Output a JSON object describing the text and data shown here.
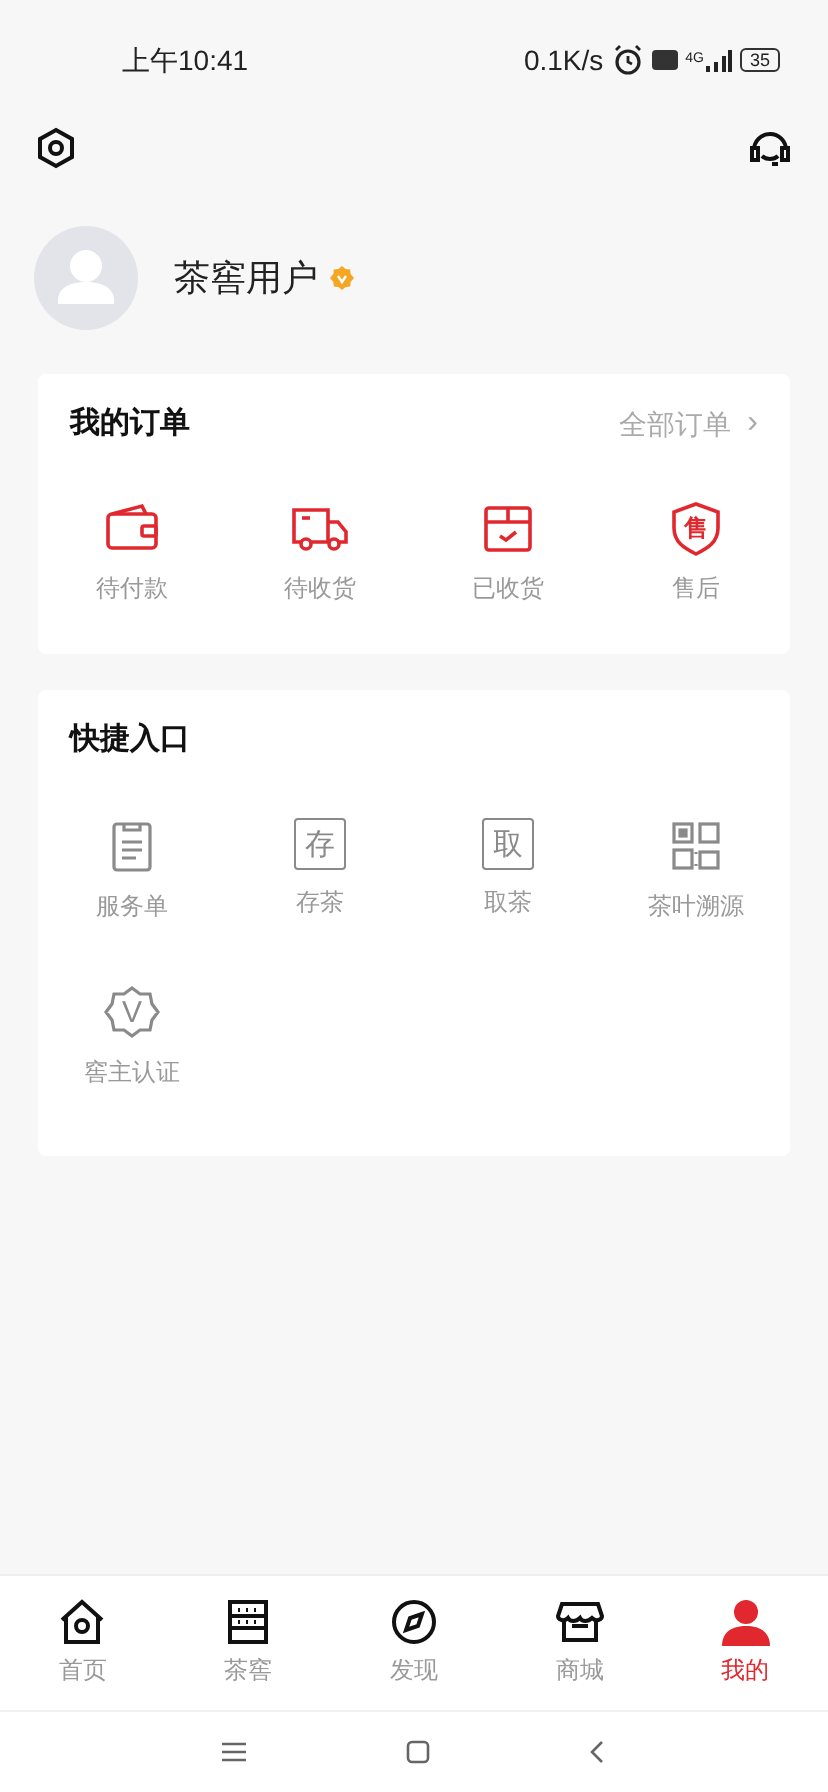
{
  "status_bar": {
    "time": "上午10:41",
    "speed": "0.1K/s",
    "network": "4G",
    "battery": "35"
  },
  "profile": {
    "name": "茶窖用户",
    "verified": true
  },
  "orders": {
    "title": "我的订单",
    "all_link": "全部订单",
    "chevron": "›",
    "items": [
      {
        "kind": "wallet",
        "label": "待付款"
      },
      {
        "kind": "truck",
        "label": "待收货"
      },
      {
        "kind": "box",
        "label": "已收货"
      },
      {
        "kind": "shield",
        "label": "售后",
        "icon_text": "售"
      }
    ]
  },
  "shortcuts": {
    "title": "快捷入口",
    "items": [
      {
        "kind": "doc",
        "label": "服务单"
      },
      {
        "kind": "char",
        "label": "存茶",
        "icon_text": "存"
      },
      {
        "kind": "char",
        "label": "取茶",
        "icon_text": "取"
      },
      {
        "kind": "qr",
        "label": "茶叶溯源"
      },
      {
        "kind": "badge",
        "label": "窖主认证",
        "icon_text": "V"
      }
    ]
  },
  "tabs": [
    {
      "kind": "home",
      "label": "首页",
      "selected": false
    },
    {
      "kind": "cellar",
      "label": "茶窖",
      "selected": false
    },
    {
      "kind": "compass",
      "label": "发现",
      "selected": false
    },
    {
      "kind": "shop",
      "label": "商城",
      "selected": false
    },
    {
      "kind": "user",
      "label": "我的",
      "selected": true
    }
  ]
}
